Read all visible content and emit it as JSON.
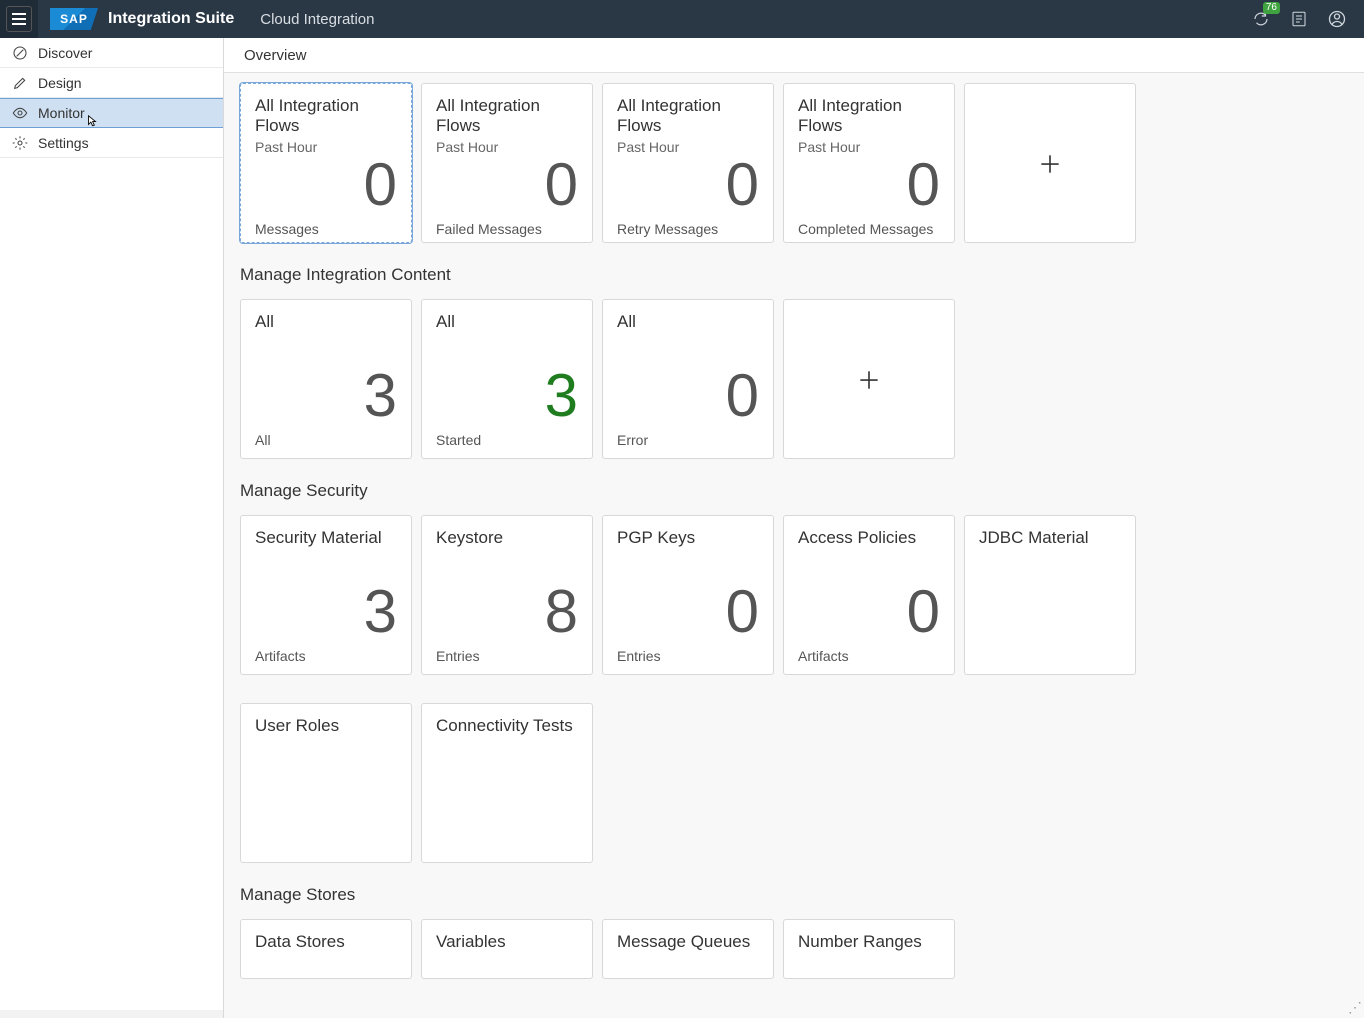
{
  "header": {
    "logo_text": "SAP",
    "suite": "Integration Suite",
    "app": "Cloud Integration",
    "notif_count": "76"
  },
  "sidebar": {
    "items": [
      {
        "label": "Discover"
      },
      {
        "label": "Design"
      },
      {
        "label": "Monitor"
      },
      {
        "label": "Settings"
      }
    ]
  },
  "overview_label": "Overview",
  "sections": {
    "message_processing": {
      "tiles": [
        {
          "title": "All Integration Flows",
          "sub": "Past Hour",
          "value": "0",
          "footer": "Messages"
        },
        {
          "title": "All Integration Flows",
          "sub": "Past Hour",
          "value": "0",
          "footer": "Failed Messages"
        },
        {
          "title": "All Integration Flows",
          "sub": "Past Hour",
          "value": "0",
          "footer": "Retry Messages"
        },
        {
          "title": "All Integration Flows",
          "sub": "Past Hour",
          "value": "0",
          "footer": "Completed Messages"
        }
      ]
    },
    "integration_content": {
      "title": "Manage Integration Content",
      "tiles": [
        {
          "title": "All",
          "value": "3",
          "footer": "All"
        },
        {
          "title": "All",
          "value": "3",
          "footer": "Started",
          "green": true
        },
        {
          "title": "All",
          "value": "0",
          "footer": "Error"
        }
      ]
    },
    "security": {
      "title": "Manage Security",
      "tiles_row1": [
        {
          "title": "Security Material",
          "value": "3",
          "footer": "Artifacts"
        },
        {
          "title": "Keystore",
          "value": "8",
          "footer": "Entries"
        },
        {
          "title": "PGP Keys",
          "value": "0",
          "footer": "Entries"
        },
        {
          "title": "Access Policies",
          "value": "0",
          "footer": "Artifacts"
        },
        {
          "title": "JDBC Material"
        }
      ],
      "tiles_row2": [
        {
          "title": "User Roles"
        },
        {
          "title": "Connectivity Tests"
        }
      ]
    },
    "stores": {
      "title": "Manage Stores",
      "tiles": [
        {
          "title": "Data Stores"
        },
        {
          "title": "Variables"
        },
        {
          "title": "Message Queues"
        },
        {
          "title": "Number Ranges"
        }
      ]
    }
  }
}
